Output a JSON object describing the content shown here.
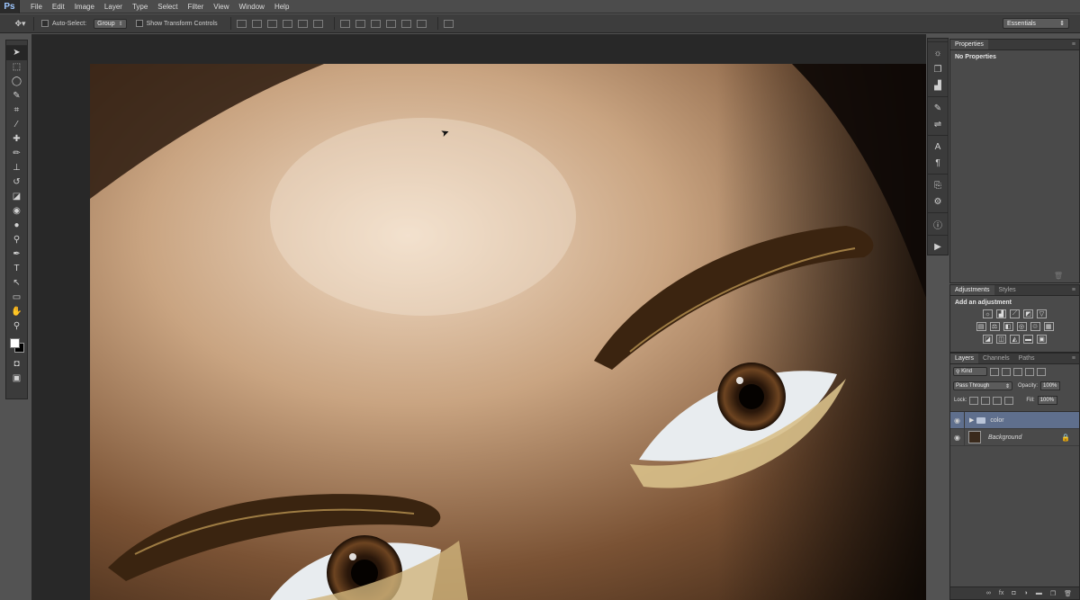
{
  "app": {
    "logo": "Ps"
  },
  "menu": [
    "File",
    "Edit",
    "Image",
    "Layer",
    "Type",
    "Select",
    "Filter",
    "View",
    "Window",
    "Help"
  ],
  "options": {
    "auto_select_label": "Auto-Select:",
    "auto_select_value": "Group",
    "transform_label": "Show Transform Controls",
    "workspace": "Essentials"
  },
  "properties": {
    "tab": "Properties",
    "message": "No Properties"
  },
  "adjustments": {
    "tabs": [
      "Adjustments",
      "Styles"
    ],
    "title": "Add an adjustment"
  },
  "layers": {
    "tabs": [
      "Layers",
      "Channels",
      "Paths"
    ],
    "filter_kind": "Kind",
    "blend_mode": "Pass Through",
    "opacity_label": "Opacity:",
    "opacity_value": "100%",
    "lock_label": "Lock:",
    "fill_label": "Fill:",
    "fill_value": "100%",
    "items": [
      {
        "name": "color",
        "type": "group",
        "selected": true
      },
      {
        "name": "Background",
        "type": "image",
        "locked": true
      }
    ]
  }
}
